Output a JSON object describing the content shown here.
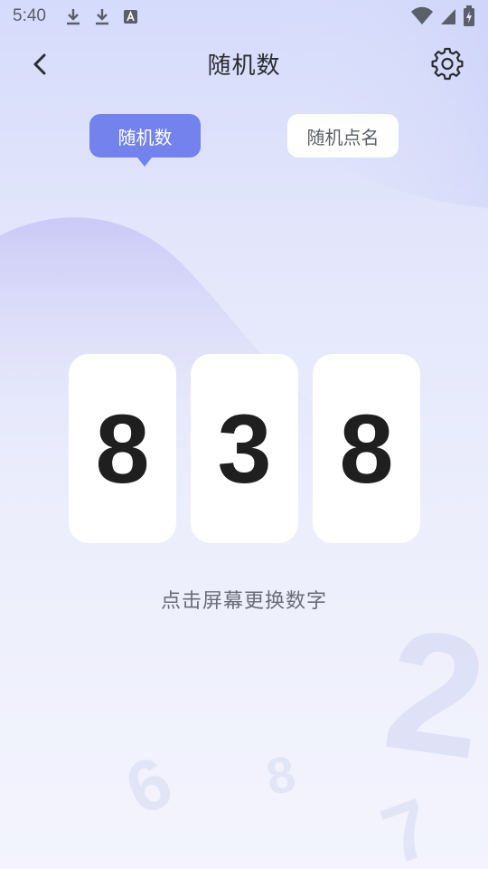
{
  "status_bar": {
    "time": "5:40",
    "left_icons": [
      "download-icon",
      "download-icon",
      "font-a-icon"
    ],
    "right_icons": [
      "wifi-icon",
      "signal-icon",
      "battery-icon"
    ]
  },
  "nav": {
    "title": "随机数",
    "back_icon": "chevron-left-icon",
    "settings_icon": "gear-icon"
  },
  "tabs": [
    {
      "label": "随机数",
      "active": true
    },
    {
      "label": "随机点名",
      "active": false
    }
  ],
  "digits": [
    "8",
    "3",
    "8"
  ],
  "hint": "点击屏幕更换数字",
  "background_numbers": [
    "2",
    "6",
    "8",
    "7"
  ],
  "colors": {
    "accent": "#7382ec",
    "card": "#ffffff",
    "digit": "#1f1f1f",
    "title": "#2b2d33",
    "hint": "#6a6d76"
  }
}
